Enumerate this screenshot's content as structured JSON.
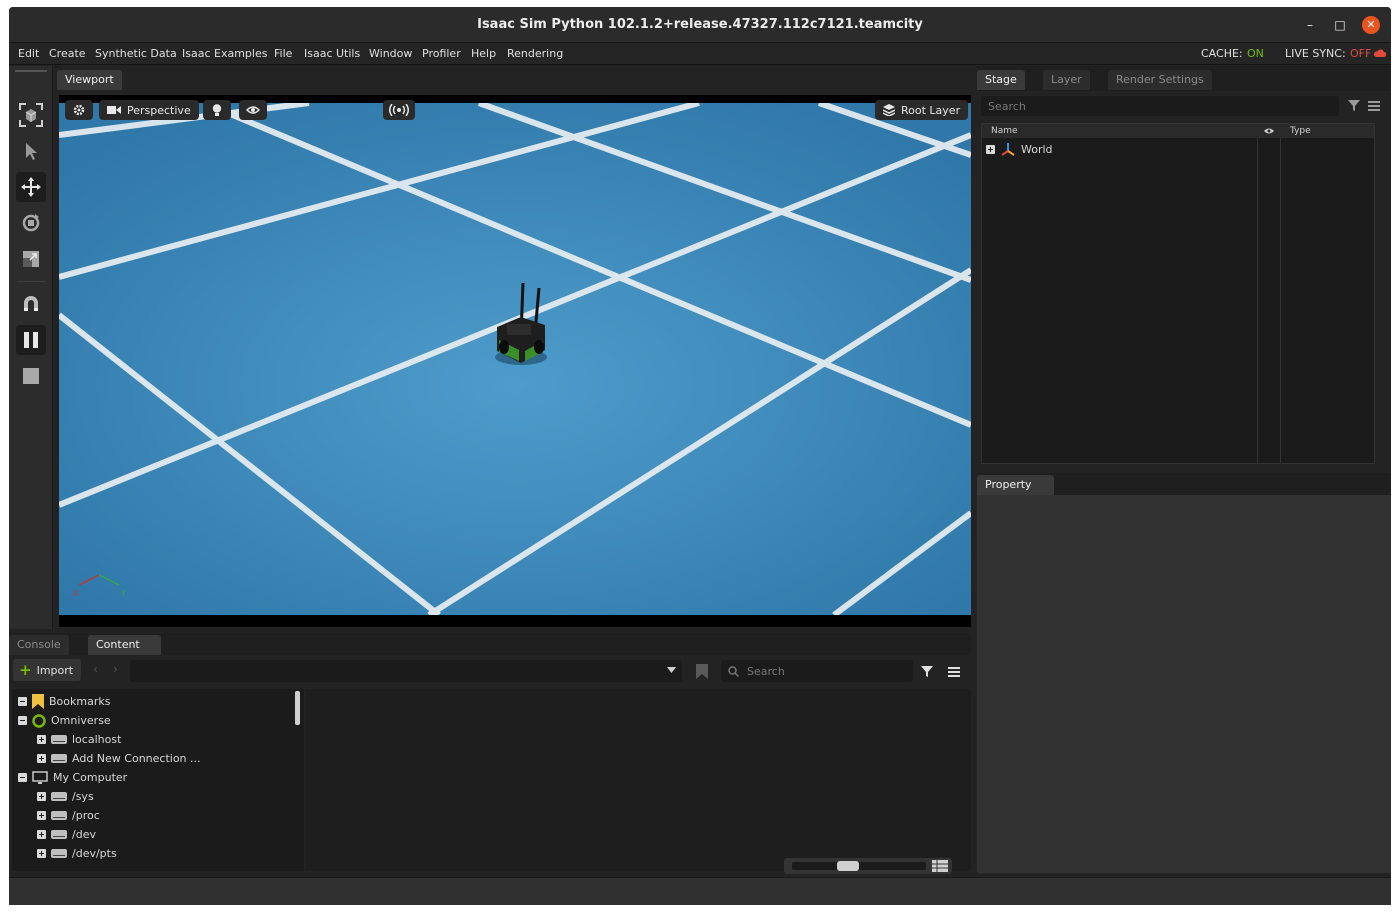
{
  "window": {
    "title": "Isaac Sim Python 102.1.2+release.47327.112c7121.teamcity"
  },
  "menubar": {
    "items": [
      "Edit",
      "Create",
      "Synthetic Data",
      "Isaac Examples",
      "File",
      "Isaac Utils",
      "Window",
      "Profiler",
      "Help",
      "Rendering"
    ],
    "cache_label": "CACHE:",
    "cache_value": "ON",
    "live_sync_label": "LIVE SYNC:",
    "live_sync_value": "OFF"
  },
  "viewport": {
    "tab_label": "Viewport",
    "camera_label": "Perspective",
    "root_layer_label": "Root Layer",
    "axis_x": "X",
    "axis_y": "Y"
  },
  "stage": {
    "tabs": [
      "Stage",
      "Layer",
      "Render Settings"
    ],
    "search_placeholder": "Search",
    "columns": {
      "name": "Name",
      "type": "Type"
    },
    "items": [
      {
        "label": "World"
      }
    ]
  },
  "property": {
    "tab_label": "Property"
  },
  "bottom": {
    "tabs": [
      "Console",
      "Content"
    ],
    "import_label": "Import",
    "search_placeholder": "Search",
    "tree": [
      {
        "label": "Bookmarks",
        "level": 0
      },
      {
        "label": "Omniverse",
        "level": 0
      },
      {
        "label": "localhost",
        "level": 1
      },
      {
        "label": "Add New Connection ...",
        "level": 1
      },
      {
        "label": "My Computer",
        "level": 0
      },
      {
        "label": "/sys",
        "level": 1
      },
      {
        "label": "/proc",
        "level": 1
      },
      {
        "label": "/dev",
        "level": 1
      },
      {
        "label": "/dev/pts",
        "level": 1
      }
    ]
  },
  "colors": {
    "accent_green": "#76b900",
    "off_red": "#e04b3c",
    "floor_blue": "#3f8fbd",
    "close_orange": "#e95420"
  }
}
